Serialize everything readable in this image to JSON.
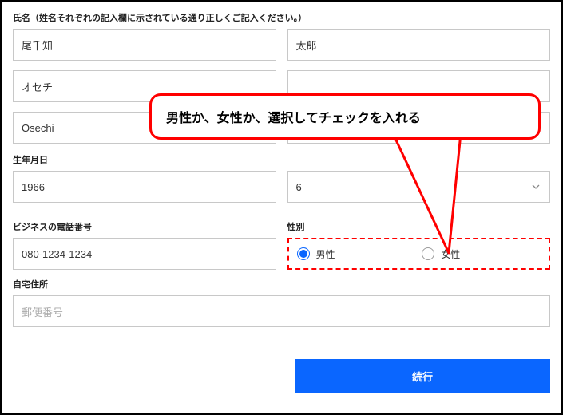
{
  "labels": {
    "name_section": "氏名（姓名それぞれの記入欄に示されている通り正しくご記入ください。）",
    "dob": "生年月日",
    "phone": "ビジネスの電話番号",
    "gender": "性別",
    "address": "自宅住所"
  },
  "name": {
    "surname_kanji": "尾千知",
    "given_kanji": "太郎",
    "surname_kana": "オセチ",
    "given_kana": "",
    "surname_romaji": "Osechi",
    "given_romaji": ""
  },
  "dob_values": {
    "year": "1966",
    "month": "6"
  },
  "phone_value": "080-1234-1234",
  "gender_options": {
    "male": "男性",
    "female": "女性"
  },
  "address_placeholder": "郵便番号",
  "submit_label": "続行",
  "callout_text": "男性か、女性か、選択してチェックを入れる"
}
